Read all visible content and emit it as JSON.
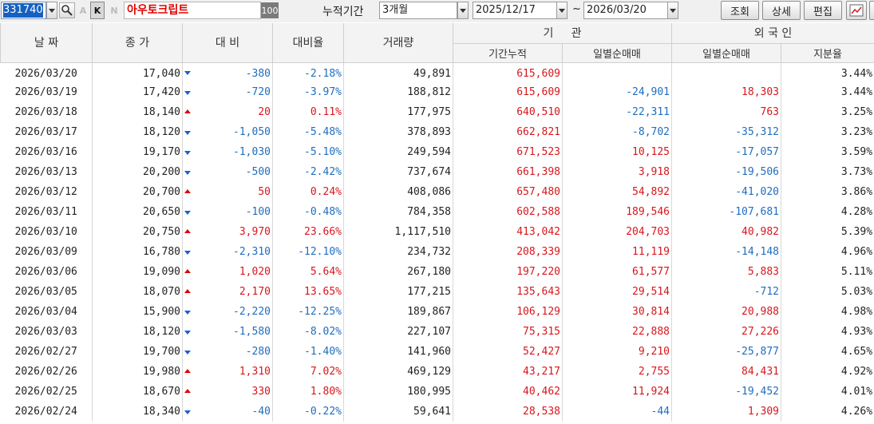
{
  "toolbar": {
    "code": "331740",
    "stock_name": "아우토크립트",
    "badge": "100",
    "btn_a": "A",
    "btn_k": "K",
    "btn_n": "N",
    "period_label": "누적기간",
    "period_value": "3개월",
    "date_from": "2025/12/17",
    "tilde": "~",
    "date_to": "2026/03/20",
    "query_label": "조회",
    "detail_label": "상세",
    "edit_label": "편집"
  },
  "columns": {
    "date": "날 짜",
    "close": "종 가",
    "change": "대 비",
    "rate": "대비율",
    "volume": "거래량",
    "institution_group": "기     관",
    "inst_cum": "기간누적",
    "inst_daily": "일별순매매",
    "foreign_group": "외 국 인",
    "for_daily": "일별순매매",
    "for_share": "지분율"
  },
  "rows": [
    {
      "date": "2026/03/20",
      "close": "17,040",
      "dir": "down",
      "change": "-380",
      "rate": "-2.18%",
      "volume": "49,891",
      "inst_cum": "615,609",
      "inst_daily": "",
      "for_daily": "",
      "for_share": "3.44%"
    },
    {
      "date": "2026/03/19",
      "close": "17,420",
      "dir": "down",
      "change": "-720",
      "rate": "-3.97%",
      "volume": "188,812",
      "inst_cum": "615,609",
      "inst_daily": "-24,901",
      "for_daily": "18,303",
      "for_share": "3.44%"
    },
    {
      "date": "2026/03/18",
      "close": "18,140",
      "dir": "up",
      "change": "20",
      "rate": "0.11%",
      "volume": "177,975",
      "inst_cum": "640,510",
      "inst_daily": "-22,311",
      "for_daily": "763",
      "for_share": "3.25%"
    },
    {
      "date": "2026/03/17",
      "close": "18,120",
      "dir": "down",
      "change": "-1,050",
      "rate": "-5.48%",
      "volume": "378,893",
      "inst_cum": "662,821",
      "inst_daily": "-8,702",
      "for_daily": "-35,312",
      "for_share": "3.23%"
    },
    {
      "date": "2026/03/16",
      "close": "19,170",
      "dir": "down",
      "change": "-1,030",
      "rate": "-5.10%",
      "volume": "249,594",
      "inst_cum": "671,523",
      "inst_daily": "10,125",
      "for_daily": "-17,057",
      "for_share": "3.59%"
    },
    {
      "date": "2026/03/13",
      "close": "20,200",
      "dir": "down",
      "change": "-500",
      "rate": "-2.42%",
      "volume": "737,674",
      "inst_cum": "661,398",
      "inst_daily": "3,918",
      "for_daily": "-19,506",
      "for_share": "3.73%"
    },
    {
      "date": "2026/03/12",
      "close": "20,700",
      "dir": "up",
      "change": "50",
      "rate": "0.24%",
      "volume": "408,086",
      "inst_cum": "657,480",
      "inst_daily": "54,892",
      "for_daily": "-41,020",
      "for_share": "3.86%"
    },
    {
      "date": "2026/03/11",
      "close": "20,650",
      "dir": "down",
      "change": "-100",
      "rate": "-0.48%",
      "volume": "784,358",
      "inst_cum": "602,588",
      "inst_daily": "189,546",
      "for_daily": "-107,681",
      "for_share": "4.28%"
    },
    {
      "date": "2026/03/10",
      "close": "20,750",
      "dir": "up",
      "change": "3,970",
      "rate": "23.66%",
      "volume": "1,117,510",
      "inst_cum": "413,042",
      "inst_daily": "204,703",
      "for_daily": "40,982",
      "for_share": "5.39%"
    },
    {
      "date": "2026/03/09",
      "close": "16,780",
      "dir": "down",
      "change": "-2,310",
      "rate": "-12.10%",
      "volume": "234,732",
      "inst_cum": "208,339",
      "inst_daily": "11,119",
      "for_daily": "-14,148",
      "for_share": "4.96%"
    },
    {
      "date": "2026/03/06",
      "close": "19,090",
      "dir": "up",
      "change": "1,020",
      "rate": "5.64%",
      "volume": "267,180",
      "inst_cum": "197,220",
      "inst_daily": "61,577",
      "for_daily": "5,883",
      "for_share": "5.11%"
    },
    {
      "date": "2026/03/05",
      "close": "18,070",
      "dir": "up",
      "change": "2,170",
      "rate": "13.65%",
      "volume": "177,215",
      "inst_cum": "135,643",
      "inst_daily": "29,514",
      "for_daily": "-712",
      "for_share": "5.03%"
    },
    {
      "date": "2026/03/04",
      "close": "15,900",
      "dir": "down",
      "change": "-2,220",
      "rate": "-12.25%",
      "volume": "189,867",
      "inst_cum": "106,129",
      "inst_daily": "30,814",
      "for_daily": "20,988",
      "for_share": "4.98%"
    },
    {
      "date": "2026/03/03",
      "close": "18,120",
      "dir": "down",
      "change": "-1,580",
      "rate": "-8.02%",
      "volume": "227,107",
      "inst_cum": "75,315",
      "inst_daily": "22,888",
      "for_daily": "27,226",
      "for_share": "4.93%"
    },
    {
      "date": "2026/02/27",
      "close": "19,700",
      "dir": "down",
      "change": "-280",
      "rate": "-1.40%",
      "volume": "141,960",
      "inst_cum": "52,427",
      "inst_daily": "9,210",
      "for_daily": "-25,877",
      "for_share": "4.65%"
    },
    {
      "date": "2026/02/26",
      "close": "19,980",
      "dir": "up",
      "change": "1,310",
      "rate": "7.02%",
      "volume": "469,129",
      "inst_cum": "43,217",
      "inst_daily": "2,755",
      "for_daily": "84,431",
      "for_share": "4.92%"
    },
    {
      "date": "2026/02/25",
      "close": "18,670",
      "dir": "up",
      "change": "330",
      "rate": "1.80%",
      "volume": "180,995",
      "inst_cum": "40,462",
      "inst_daily": "11,924",
      "for_daily": "-19,452",
      "for_share": "4.01%"
    },
    {
      "date": "2026/02/24",
      "close": "18,340",
      "dir": "down",
      "change": "-40",
      "rate": "-0.22%",
      "volume": "59,641",
      "inst_cum": "28,538",
      "inst_daily": "-44",
      "for_daily": "1,309",
      "for_share": "4.26%"
    }
  ]
}
